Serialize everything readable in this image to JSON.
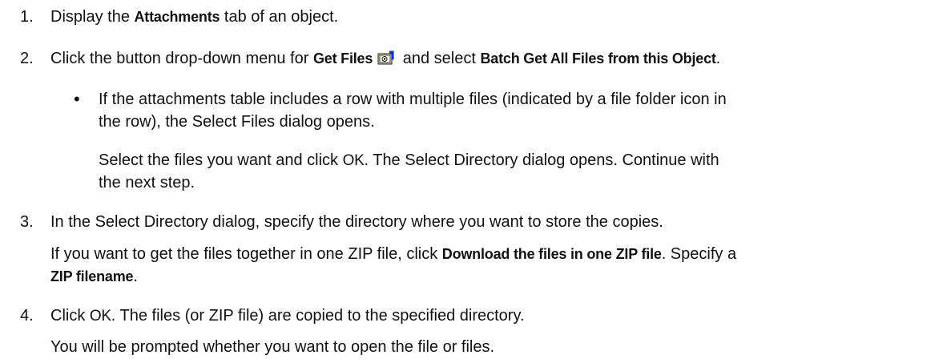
{
  "steps": [
    {
      "number": "1.",
      "parts": [
        "Display the ",
        "Attachments",
        " tab of an object."
      ]
    },
    {
      "number": "2.",
      "parts": [
        "Click the button drop-down menu for ",
        "Get Files",
        " and select ",
        "Batch Get All Files from this Object",
        "."
      ],
      "icon": "get-files-icon",
      "bullet": {
        "lines": [
          "If the attachments table includes a row with multiple files (indicated by a file folder icon in",
          "the row), the Select Files dialog opens."
        ],
        "follow_line1_parts": [
          "Select the files you want and click ",
          "OK",
          ". The Select Directory dialog opens. Continue with"
        ],
        "follow_line2": "the next step."
      }
    },
    {
      "number": "3.",
      "line1": "In the Select Directory dialog, specify the directory where you want to store the copies.",
      "line2_parts": [
        "If you want to get the files together in one ZIP file, click ",
        "Download the files in one ZIP file",
        ". Specify a"
      ],
      "line3_parts": [
        "ZIP filename",
        "."
      ]
    },
    {
      "number": "4.",
      "parts": [
        "Click ",
        "OK",
        ". The files (or ZIP file) are copied to the specified directory."
      ],
      "line2": "You will be prompted whether you want to open the file or files."
    }
  ]
}
